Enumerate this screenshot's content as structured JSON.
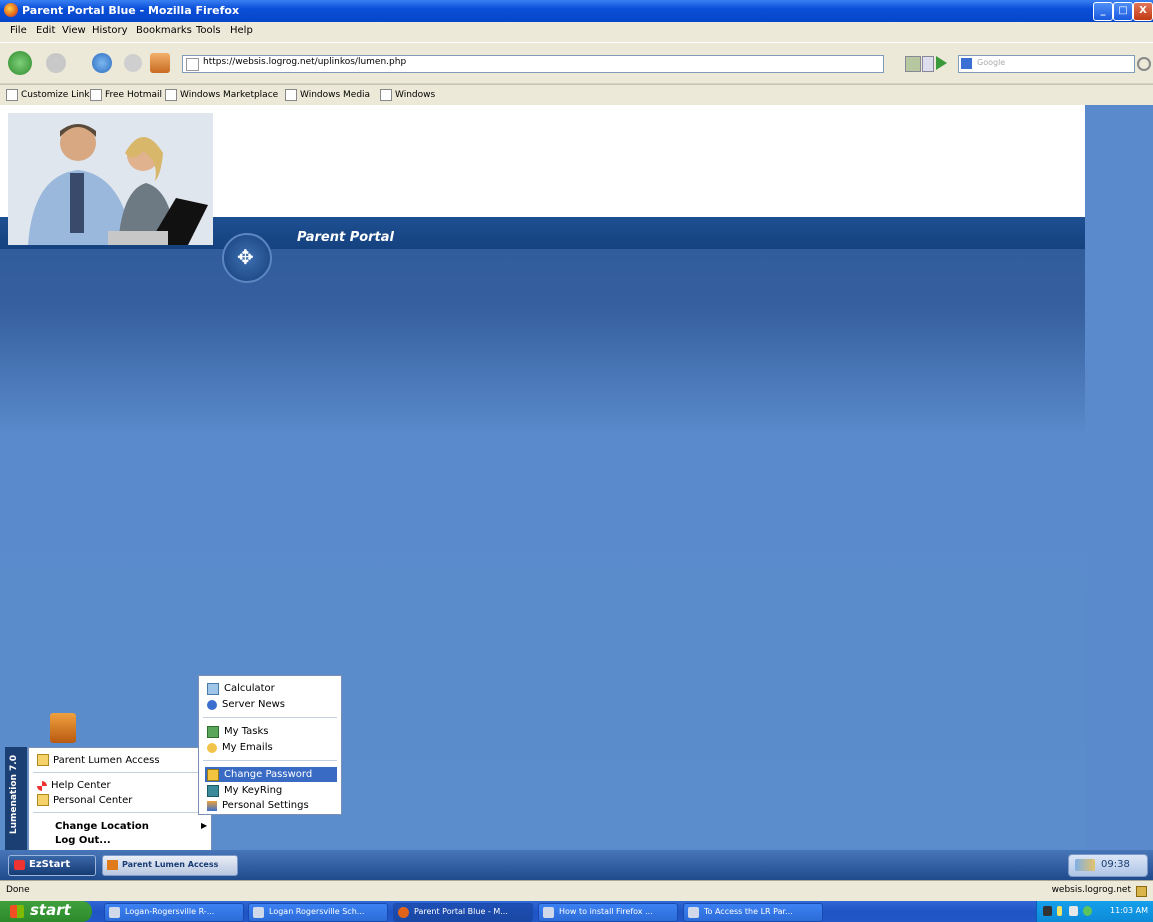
{
  "window": {
    "title": "Parent Portal Blue - Mozilla Firefox",
    "buttons": {
      "minimize": "_",
      "maximize": "□",
      "close": "X"
    }
  },
  "menubar": [
    "File",
    "Edit",
    "View",
    "History",
    "Bookmarks",
    "Tools",
    "Help"
  ],
  "navbar": {
    "url": "https://websis.logrog.net/uplinkos/lumen.php",
    "search_placeholder": "Google"
  },
  "bookmarks": [
    "Customize Links",
    "Free Hotmail",
    "Windows Marketplace",
    "Windows Media",
    "Windows"
  ],
  "page": {
    "portal_title": "Parent Portal",
    "emblem_icon": "compass-icon"
  },
  "lumen": {
    "vertical_label": "Lumenation 7.0",
    "start_menu": {
      "items": [
        {
          "label": "Parent Lumen Access",
          "icon": "folder-icon"
        },
        {
          "label": "Help Center",
          "icon": "lifebuoy-icon"
        },
        {
          "label": "Personal Center",
          "icon": "folder-icon"
        },
        {
          "label": "Change Location",
          "icon": ""
        },
        {
          "label": "Log Out...",
          "icon": ""
        }
      ],
      "arrow": "▶"
    },
    "submenu": {
      "items": [
        {
          "label": "Calculator",
          "icon": "calculator-icon"
        },
        {
          "label": "Server News",
          "icon": "news-icon"
        },
        {
          "label": "My Tasks",
          "icon": "tasks-icon"
        },
        {
          "label": "My Emails",
          "icon": "email-icon"
        },
        {
          "label": "Change Password",
          "icon": "lock-icon",
          "selected": true
        },
        {
          "label": "My KeyRing",
          "icon": "keyring-icon"
        },
        {
          "label": "Personal Settings",
          "icon": "settings-icon"
        }
      ]
    },
    "taskbar": {
      "ezstart": "EzStart",
      "window_button": "Parent Lumen Access",
      "clock": "09:38"
    }
  },
  "statusbar": {
    "status": "Done",
    "site": "websis.logrog.net"
  },
  "xp_taskbar": {
    "start": "start",
    "tasks": [
      "Logan-Rogersville R-...",
      "Logan Rogersville Sch...",
      "Parent Portal Blue - M...",
      "How to install Firefox ...",
      "To Access the LR Par..."
    ],
    "clock": "11:03 AM"
  },
  "colors": {
    "xp_blue": "#0a4fd8",
    "portal_dark": "#15427f",
    "portal_light": "#5b8ccb",
    "menu_selected": "#3a6bc4"
  }
}
